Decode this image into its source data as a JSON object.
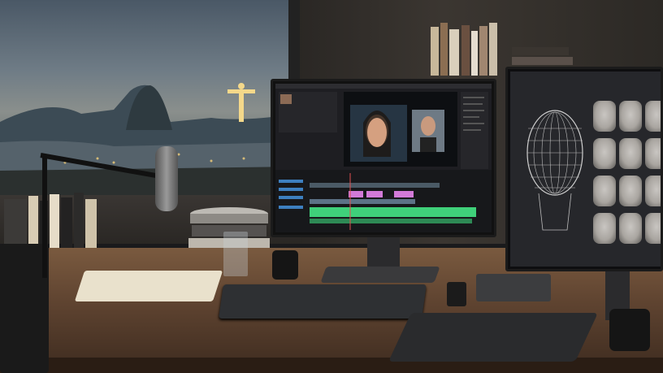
{
  "scene": {
    "description_visible_text": [],
    "colors": {
      "sky": "#4a5866",
      "desk": "#6b4c35",
      "timeline_green": "#3fd07a",
      "timeline_magenta": "#d27ad8",
      "screen_dark": "#1e1e22"
    }
  },
  "objects": {
    "left_monitor": {
      "icon": "video-editor-screen"
    },
    "right_monitor": {
      "icon": "face-model-grid-screen"
    }
  }
}
